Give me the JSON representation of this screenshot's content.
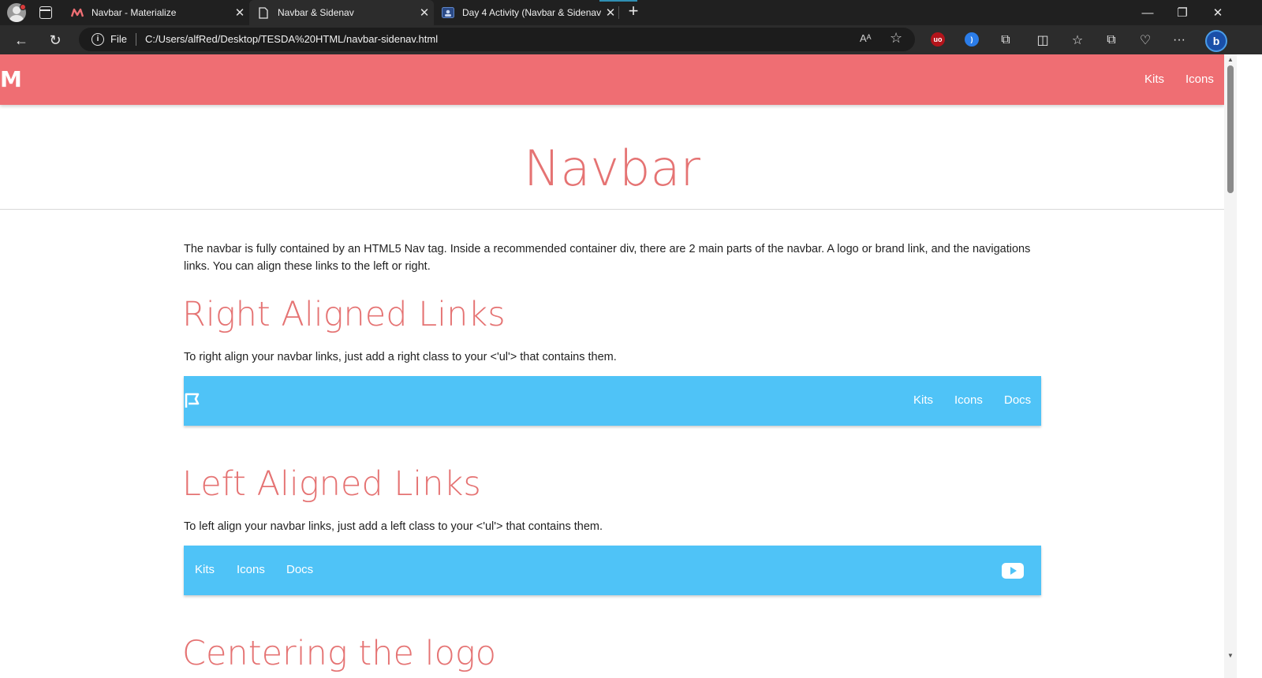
{
  "browser": {
    "tabs": [
      {
        "title": "Navbar - Materialize",
        "active": false
      },
      {
        "title": "Navbar & Sidenav",
        "active": true
      },
      {
        "title": "Day 4 Activity (Navbar & Sidenav",
        "active": false
      }
    ],
    "address": {
      "scheme": "File",
      "url": "C:/Users/alfRed/Desktop/TESDA%20HTML/navbar-sidenav.html"
    },
    "colors": {
      "tabbar": "#202020",
      "toolbar": "#2c2c2c"
    }
  },
  "site_nav": {
    "logo": "M",
    "links": [
      "Kits",
      "Icons"
    ],
    "color": "#ef6e73"
  },
  "page": {
    "title": "Navbar",
    "intro": "The navbar is fully contained by an HTML5 Nav tag. Inside a recommended container div, there are 2 main parts of the navbar. A logo or brand link, and the navigations links. You can align these links to the left or right.",
    "sections": [
      {
        "heading": "Right Aligned Links",
        "text": "To right align your navbar links, just add a right class to your <'ul'> that contains them.",
        "demo_links": [
          "Kits",
          "Icons",
          "Docs"
        ],
        "demo_icon": "flag-icon"
      },
      {
        "heading": "Left Aligned Links",
        "text": "To left align your navbar links, just add a left class to your <'ul'> that contains them.",
        "demo_links": [
          "Kits",
          "Icons",
          "Docs"
        ],
        "demo_icon": "youtube-icon"
      },
      {
        "heading": "Centering the logo"
      }
    ],
    "accent": "#e57373",
    "demo_color": "#4fc3f7"
  }
}
